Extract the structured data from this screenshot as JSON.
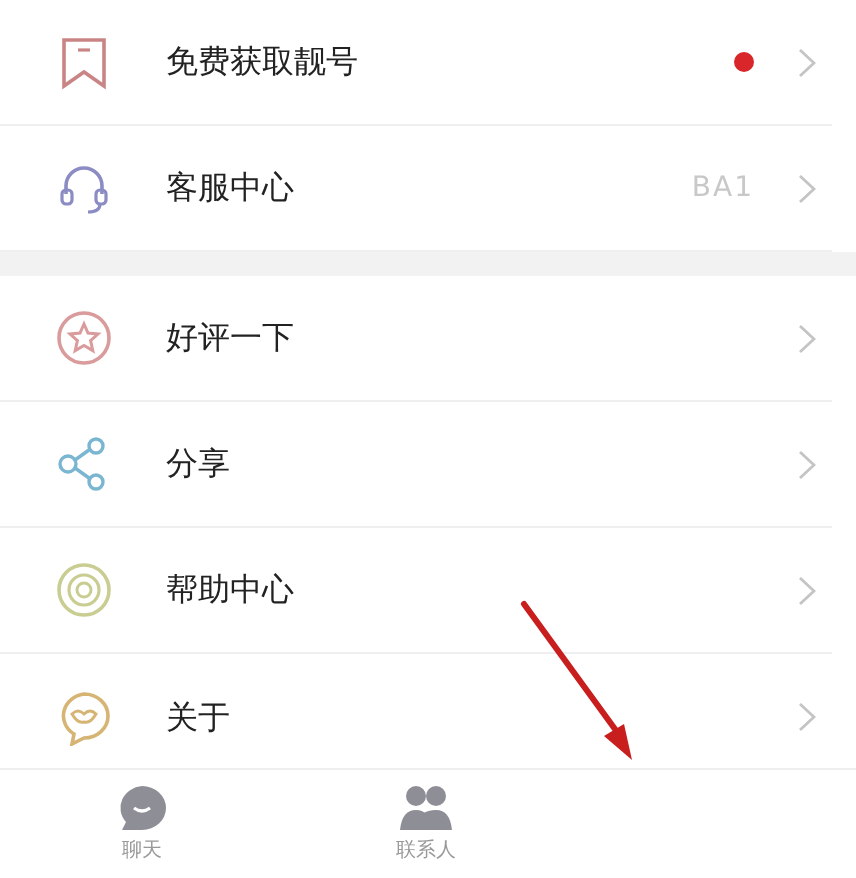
{
  "sections": [
    {
      "items": [
        {
          "label": "免费获取靓号",
          "dot": true
        },
        {
          "label": "客服中心",
          "value": "BA1"
        }
      ]
    },
    {
      "items": [
        {
          "label": "好评一下"
        },
        {
          "label": "分享"
        },
        {
          "label": "帮助中心"
        },
        {
          "label": "关于"
        }
      ]
    }
  ],
  "bottom_nav": [
    {
      "label": "聊天",
      "selected": false
    },
    {
      "label": "联系人",
      "selected": false
    }
  ]
}
